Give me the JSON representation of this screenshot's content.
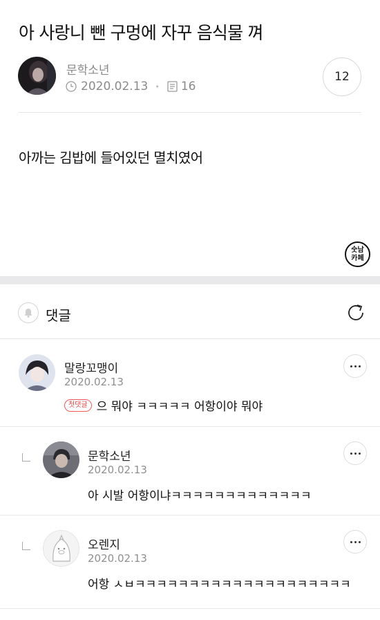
{
  "post": {
    "title": "아 사랑니 뺀 구멍에 자꾸 음식물 껴",
    "author": "문학소년",
    "date": "2020.02.13",
    "views": "16",
    "comment_count": "12",
    "body": "아까는 김밥에 들어있던 멸치였어"
  },
  "cafe_badge": {
    "line1": "숫남",
    "line2": "카페"
  },
  "comments_section": {
    "label": "댓글"
  },
  "comments": [
    {
      "author": "말랑꼬맹이",
      "date": "2020.02.13",
      "badge": "첫댓글",
      "text": "으 뭐야 ㅋㅋㅋㅋㅋ 어항이야 뭐야",
      "is_reply": false
    },
    {
      "author": "문학소년",
      "date": "2020.02.13",
      "text": "아 시발 어항이냐ㅋㅋㅋㅋㅋㅋㅋㅋㅋㅋㅋㅋㅋ",
      "is_reply": true
    },
    {
      "author": "오렌지",
      "date": "2020.02.13",
      "text": "어항 ㅅㅂㅋㅋㅋㅋㅋㅋㅋㅋㅋㅋㅋㅋㅋㅋㅋㅋㅋㅋㅋㅋ",
      "is_reply": true
    }
  ],
  "colors": {
    "accent_red": "#e24646",
    "muted_text": "#8a8a8a",
    "section_gap": "#e9e9ec"
  },
  "icons": [
    "clock-icon",
    "document-icon",
    "bell-icon",
    "refresh-icon",
    "more-icon",
    "reply-arrow-icon"
  ]
}
